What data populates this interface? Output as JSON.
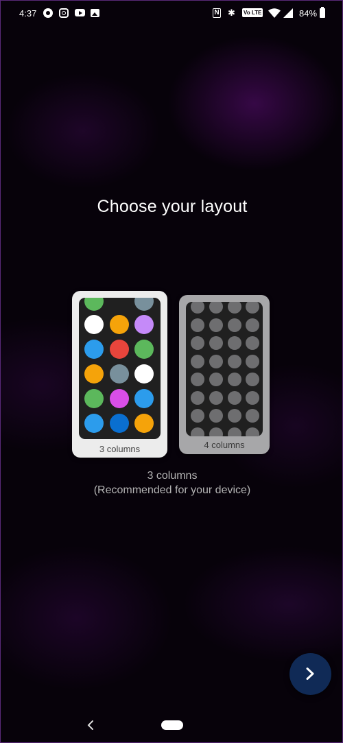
{
  "status_bar": {
    "time": "4:37",
    "left_icons": [
      "circle-app-icon",
      "instagram-icon",
      "youtube-icon",
      "photos-icon"
    ],
    "right_icons": [
      "nfc-icon",
      "bluetooth-icon",
      "volte-icon",
      "wifi-icon",
      "signal-icon",
      "battery-icon"
    ],
    "nfc_glyph": "N",
    "bluetooth_glyph": "✱",
    "volte_label": "Vo LTE",
    "battery_percent": "84%"
  },
  "title": "Choose your layout",
  "layouts": [
    {
      "label": "3 columns",
      "selected": true,
      "dot_colors": [
        [
          "#5cb85c",
          null,
          "#78909c"
        ],
        [
          "#ffffff",
          "#f5a30a",
          "#c58af9"
        ],
        [
          "#2c9cec",
          "#e8453c",
          "#5cb85c"
        ],
        [
          "#f5a30a",
          "#78909c",
          "#ffffff"
        ],
        [
          "#5cb85c",
          "#d94ee8",
          "#2c9cec"
        ],
        [
          "#2c9cec",
          "#0a6fd0",
          "#f5a30a"
        ]
      ]
    },
    {
      "label": "4 columns",
      "selected": false,
      "dot_color": "#6e6e70"
    }
  ],
  "caption": {
    "line1": "3 columns",
    "line2": "(Recommended for your device)"
  },
  "next_button": {
    "icon": "chevron-right-icon",
    "color": "#102a56"
  },
  "nav_bar": {
    "back_icon": "back-icon",
    "home": "home-pill"
  }
}
